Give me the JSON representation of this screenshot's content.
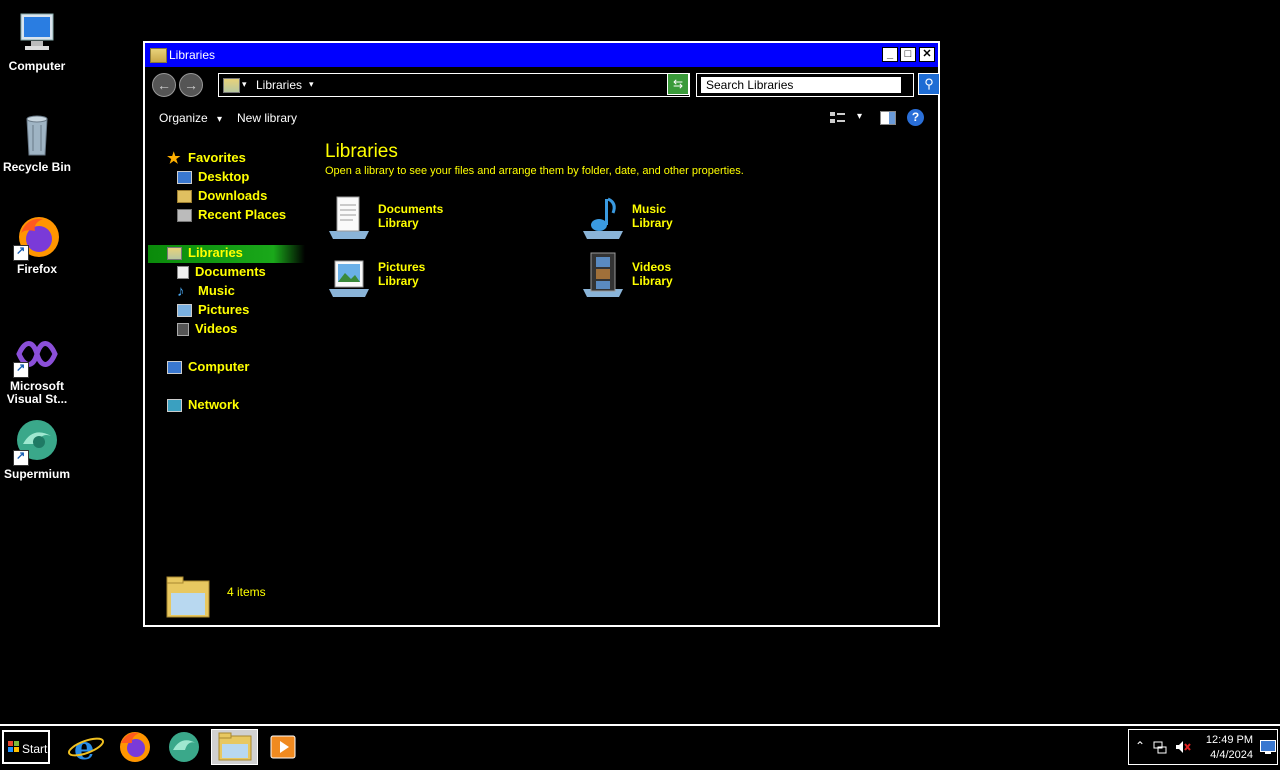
{
  "desktop": {
    "icons": [
      {
        "label": "Computer",
        "icon": "computer-icon"
      },
      {
        "label": "Recycle Bin",
        "icon": "recycle-bin-icon"
      },
      {
        "label": "Firefox",
        "icon": "firefox-icon"
      },
      {
        "label": "Microsoft Visual St...",
        "icon": "visual-studio-icon"
      },
      {
        "label": "Supermium",
        "icon": "supermium-icon"
      }
    ]
  },
  "window": {
    "title": "Libraries",
    "controls": {
      "minimize": "_",
      "maximize": "□",
      "close": "✕"
    },
    "address": {
      "crumb": "Libraries",
      "sep": "▾"
    },
    "search": {
      "placeholder": "Search Libraries",
      "value": "Search Libraries"
    },
    "toolbar": {
      "organize": "Organize",
      "new_library": "New library",
      "dropdown": "▾",
      "help": "?"
    },
    "nav": {
      "favorites": "Favorites",
      "desktop": "Desktop",
      "downloads": "Downloads",
      "recent": "Recent Places",
      "libraries": "Libraries",
      "documents": "Documents",
      "music": "Music",
      "pictures": "Pictures",
      "videos": "Videos",
      "computer": "Computer",
      "network": "Network"
    },
    "content": {
      "title": "Libraries",
      "description": "Open a library to see your files and arrange them by folder, date, and other properties.",
      "libraries": [
        {
          "name": "Documents",
          "sub": "Library"
        },
        {
          "name": "Music",
          "sub": "Library"
        },
        {
          "name": "Pictures",
          "sub": "Library"
        },
        {
          "name": "Videos",
          "sub": "Library"
        }
      ]
    },
    "status": {
      "count": "4 items"
    }
  },
  "taskbar": {
    "start": "Start",
    "clock": {
      "time": "12:49 PM",
      "date": "4/4/2024"
    },
    "tray_arrow": "⌃"
  },
  "colors": {
    "accent_text": "#ffff00",
    "titlebar": "#0000ff",
    "selection": "#1aa81a"
  }
}
